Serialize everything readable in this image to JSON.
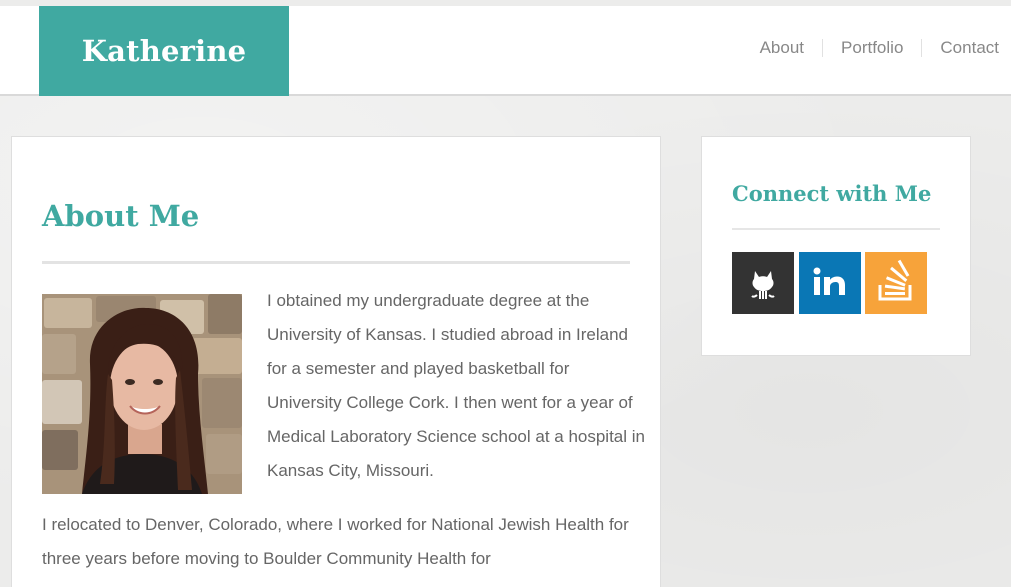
{
  "header": {
    "logo": "Katherine",
    "nav": [
      "About",
      "Portfolio",
      "Contact"
    ]
  },
  "main": {
    "title": "About Me",
    "paragraph1": "I obtained my undergraduate degree at the University of Kansas. I studied abroad in Ireland for a semester and played basketball for University College Cork. I then went for a year of Medical Laboratory Science school at a hospital in Kansas City, Missouri.",
    "paragraph2": "I relocated to Denver, Colorado, where I worked for National Jewish Health for three years before moving to Boulder Community Health for"
  },
  "sidebar": {
    "title": "Connect with Me",
    "links": [
      {
        "icon": "github-icon",
        "color": "#333333"
      },
      {
        "icon": "linkedin-icon",
        "color": "#0a77b5"
      },
      {
        "icon": "stackoverflow-icon",
        "color": "#f7a33a"
      }
    ]
  },
  "colors": {
    "accent": "#40a9a1",
    "text": "#666666"
  }
}
